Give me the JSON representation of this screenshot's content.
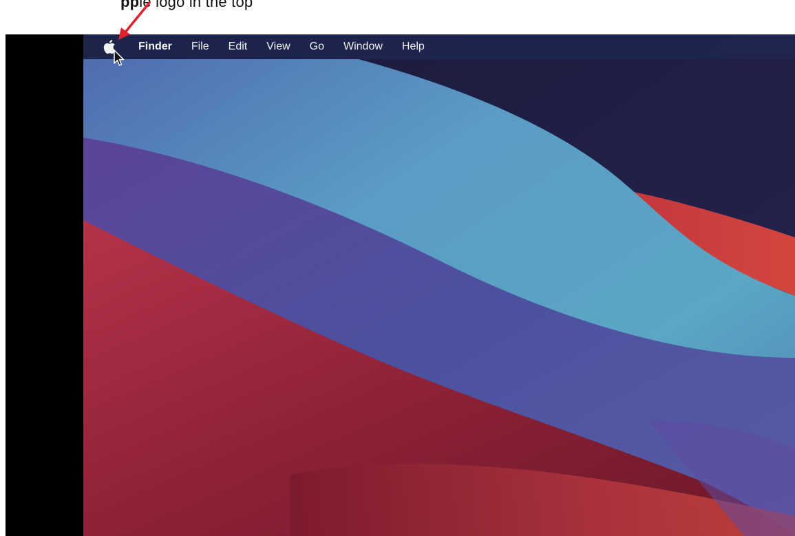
{
  "caption": {
    "bold_text": "pp",
    "text": "le logo in the top"
  },
  "menubar": {
    "apple_icon": "apple-logo-icon",
    "app_name": "Finder",
    "items": [
      {
        "label": "File"
      },
      {
        "label": "Edit"
      },
      {
        "label": "View"
      },
      {
        "label": "Go"
      },
      {
        "label": "Window"
      },
      {
        "label": "Help"
      }
    ]
  },
  "colors": {
    "annotation_arrow": "#e0202a",
    "menubar_text": "#f2f2f2",
    "wallpaper_dark_navy": "#1d1d45",
    "wallpaper_cyan": "#5aa6c4",
    "wallpaper_purple": "#5a3f96",
    "wallpaper_red": "#c2373e"
  }
}
